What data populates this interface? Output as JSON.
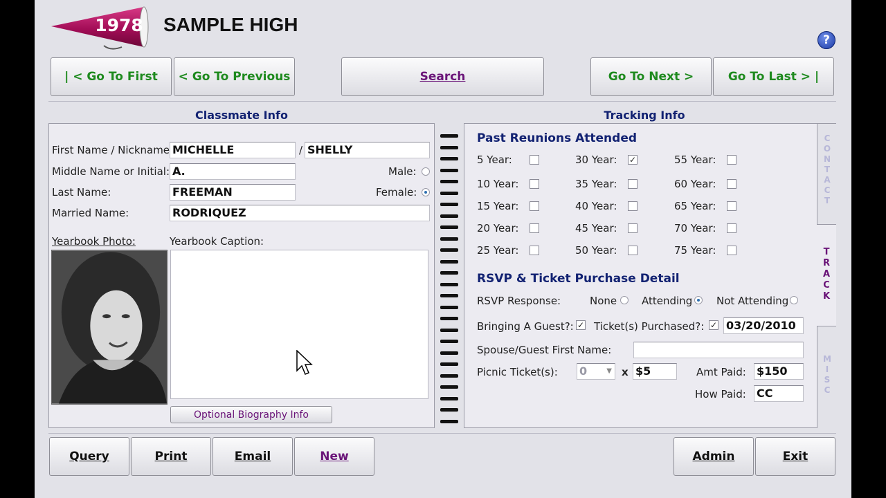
{
  "header": {
    "year": "1978",
    "school_name": "SAMPLE HIGH",
    "help_icon": "question-icon",
    "help_label": "?"
  },
  "nav": {
    "first": "| < Go To First",
    "previous": "< Go To Previous",
    "search": "Search",
    "next": "Go To Next >",
    "last": "Go To Last > |"
  },
  "classmate": {
    "title": "Classmate Info",
    "first_name_label": "First Name / Nickname:",
    "first_name": "MICHELLE",
    "slash": "/",
    "nickname": "SHELLY",
    "middle_label": "Middle Name or Initial:",
    "middle": "A.",
    "last_label": "Last Name:",
    "last": "FREEMAN",
    "married_label": "Married Name:",
    "married": "RODRIQUEZ",
    "male_label": "Male:",
    "female_label": "Female:",
    "gender": "Female",
    "photo_label": "Yearbook Photo:",
    "caption_label": "Yearbook Caption:",
    "caption": "",
    "bio_button": "Optional Biography Info"
  },
  "tracking": {
    "title": "Tracking Info",
    "reunions_title": "Past Reunions Attended",
    "reunions": [
      {
        "label": "5 Year:",
        "checked": false
      },
      {
        "label": "10 Year:",
        "checked": false
      },
      {
        "label": "15 Year:",
        "checked": false
      },
      {
        "label": "20 Year:",
        "checked": false
      },
      {
        "label": "25 Year:",
        "checked": false
      },
      {
        "label": "30 Year:",
        "checked": true
      },
      {
        "label": "35 Year:",
        "checked": false
      },
      {
        "label": "40 Year:",
        "checked": false
      },
      {
        "label": "45 Year:",
        "checked": false
      },
      {
        "label": "50 Year:",
        "checked": false
      },
      {
        "label": "55 Year:",
        "checked": false
      },
      {
        "label": "60 Year:",
        "checked": false
      },
      {
        "label": "65 Year:",
        "checked": false
      },
      {
        "label": "70 Year:",
        "checked": false
      },
      {
        "label": "75 Year:",
        "checked": false
      }
    ],
    "rsvp_title": "RSVP & Ticket Purchase Detail",
    "rsvp_label": "RSVP Response:",
    "rsvp_none": "None",
    "rsvp_attending": "Attending",
    "rsvp_not_attending": "Not Attending",
    "rsvp_selected": "Attending",
    "guest_label": "Bringing A Guest?:",
    "guest_checked": true,
    "tickets_label": "Ticket(s) Purchased?:",
    "tickets_checked": true,
    "ticket_date": "03/20/2010",
    "spouse_label": "Spouse/Guest First Name:",
    "spouse": "",
    "picnic_label": "Picnic Ticket(s):",
    "picnic_qty": "0",
    "times": "x",
    "picnic_price": "$5",
    "amt_paid_label": "Amt Paid:",
    "amt_paid": "$150",
    "how_paid_label": "How Paid:",
    "how_paid": "CC"
  },
  "tabs": {
    "contact": "CONTACT",
    "track": "TRACK",
    "misc": "MISC"
  },
  "footer": {
    "query": "Query",
    "print": "Print",
    "email": "Email",
    "new": "New",
    "admin": "Admin",
    "exit": "Exit"
  },
  "colors": {
    "nav_text": "#1e8a1e",
    "section_title": "#122272",
    "accent_purple": "#6a1478",
    "megaphone": "#a0105a"
  }
}
